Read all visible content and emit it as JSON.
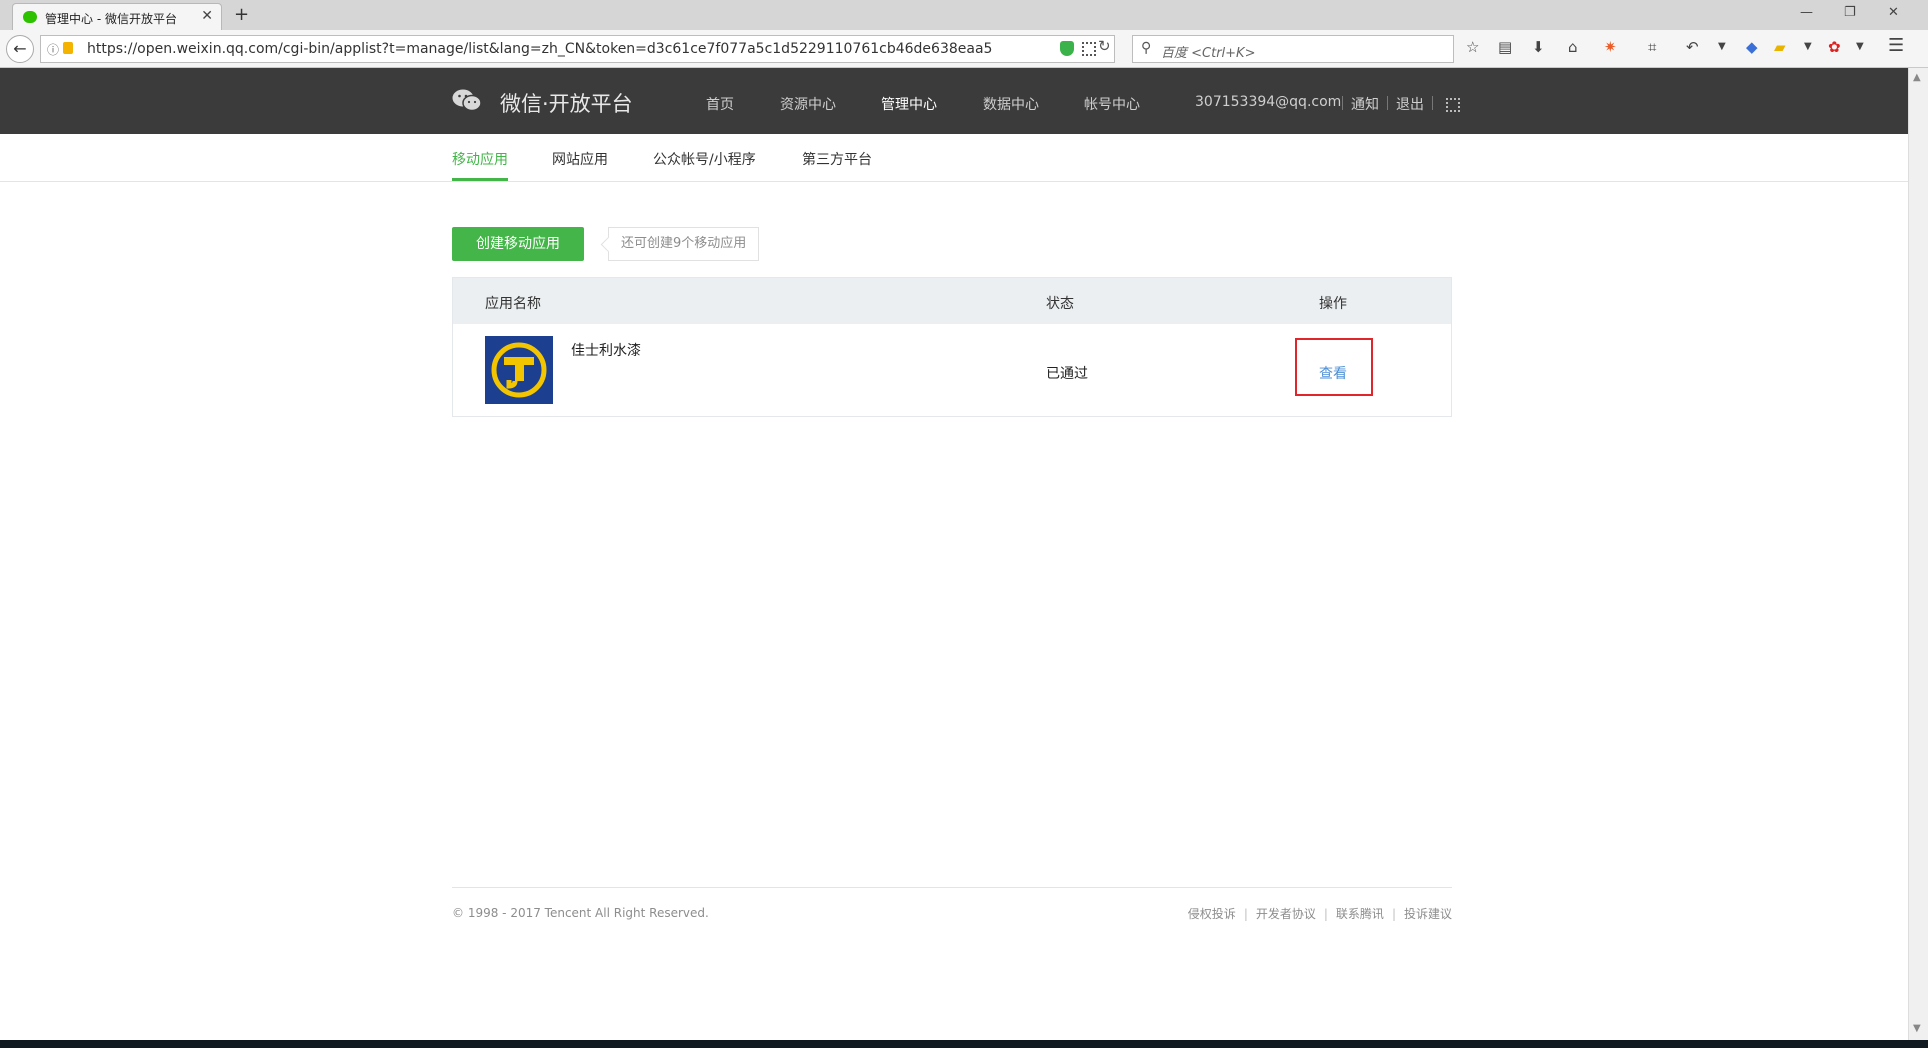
{
  "browser": {
    "tab_title": "管理中心 - 微信开放平台",
    "url": "https://open.weixin.qq.com/cgi-bin/applist?t=manage/list&lang=zh_CN&token=d3c61ce7f077a5c1d5229110761cb46de638eaa5",
    "search_placeholder": "百度 <Ctrl+K>"
  },
  "header": {
    "logo_text": "微信·开放平台",
    "nav": [
      "首页",
      "资源中心",
      "管理中心",
      "数据中心",
      "帐号中心"
    ],
    "active_nav": "管理中心",
    "user_email": "307153394@qq.com",
    "notify": "通知",
    "logout": "退出"
  },
  "subnav": {
    "tabs": [
      "移动应用",
      "网站应用",
      "公众帐号/小程序",
      "第三方平台"
    ],
    "active": "移动应用"
  },
  "actions": {
    "create_button": "创建移动应用",
    "hint": "还可创建9个移动应用"
  },
  "table": {
    "headers": {
      "name": "应用名称",
      "status": "状态",
      "op": "操作"
    },
    "rows": [
      {
        "name": "佳士利水漆",
        "status": "已通过",
        "action": "查看"
      }
    ]
  },
  "footer": {
    "copyright": "© 1998 - 2017 Tencent All Right Reserved.",
    "links": [
      "侵权投诉",
      "开发者协议",
      "联系腾讯",
      "投诉建议"
    ]
  },
  "colors": {
    "accent_green": "#44b549",
    "header_bg": "#3b3b3b",
    "link_blue": "#4c8fd6",
    "highlight_red": "#e0262b"
  }
}
